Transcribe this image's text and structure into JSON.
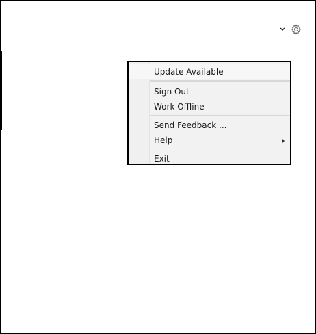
{
  "header": {
    "dropdown_icon": "chevron-down-icon",
    "settings_icon": "gear-icon"
  },
  "menu": {
    "items": [
      {
        "label": "Update Available"
      },
      {
        "label": "Sign Out"
      },
      {
        "label": "Work Offline"
      },
      {
        "label": "Send Feedback ..."
      },
      {
        "label": "Help",
        "has_submenu": true
      },
      {
        "label": "Exit"
      }
    ]
  },
  "colors": {
    "border": "#000000",
    "menu_background": "#f2f2f2",
    "separator": "#d7d7d7",
    "text": "#1a1a1a"
  }
}
